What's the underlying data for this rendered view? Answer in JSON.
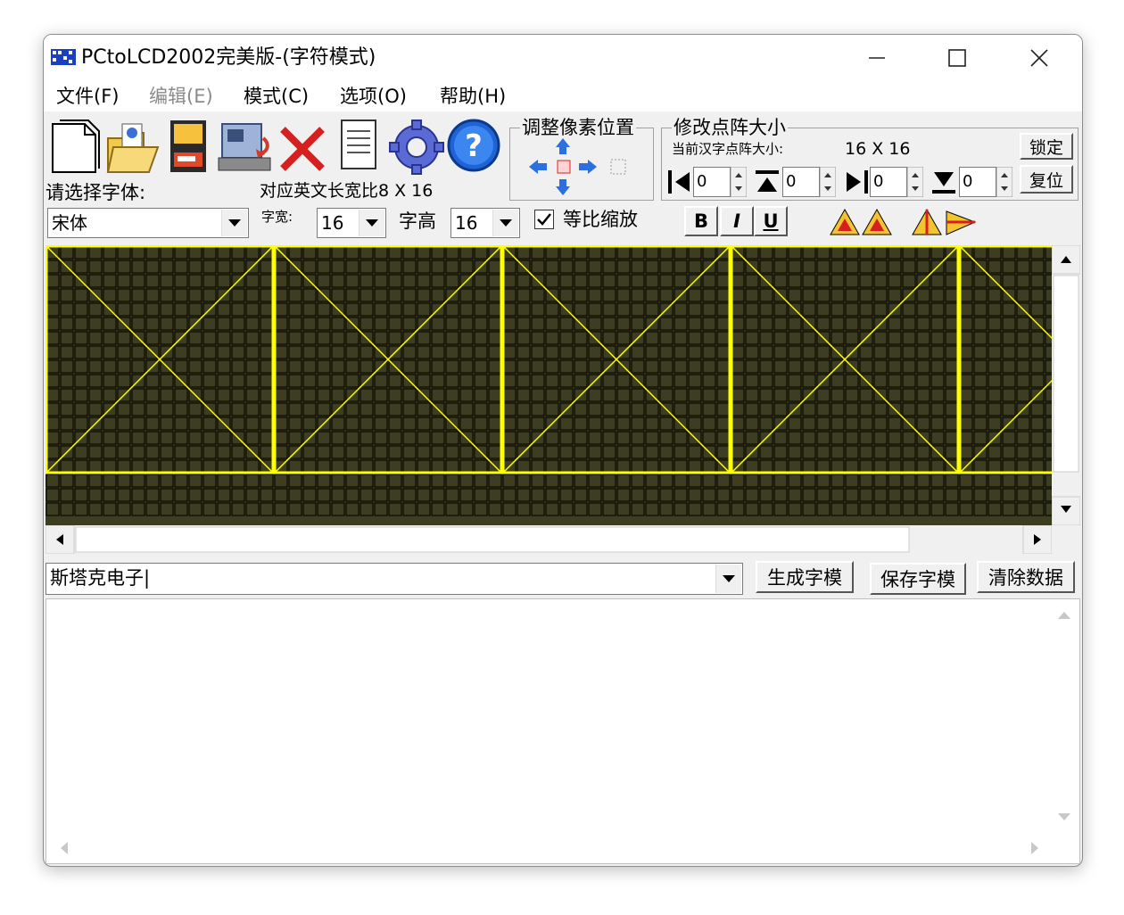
{
  "window": {
    "title": "PCtoLCD2002完美版-(字符模式)"
  },
  "menu": [
    {
      "label": "文件(F)",
      "enabled": true
    },
    {
      "label": "编辑(E)",
      "enabled": false
    },
    {
      "label": "模式(C)",
      "enabled": true
    },
    {
      "label": "选项(O)",
      "enabled": true
    },
    {
      "label": "帮助(H)",
      "enabled": true
    }
  ],
  "toolbar": {
    "icons": [
      "new-file-icon",
      "open-folder-icon",
      "save-disk-icon",
      "import-image-icon",
      "delete-icon",
      "notepad-icon",
      "settings-gear-icon",
      "help-icon"
    ]
  },
  "adjust_pixel": {
    "title": "调整像素位置"
  },
  "resize": {
    "title": "修改点阵大小",
    "current_label": "当前汉字点阵大小:",
    "current_value": "16 X 16",
    "lock_button": "锁定",
    "reset_button": "复位",
    "spinners": [
      "0",
      "0",
      "0",
      "0"
    ]
  },
  "font": {
    "select_label": "请选择字体:",
    "ratio_label": "对应英文长宽比8 X 16",
    "name": "宋体",
    "width_label": "字宽:",
    "width_value": "16",
    "height_label": "字高",
    "height_value": "16",
    "proportional_label": "等比缩放",
    "proportional_checked": true
  },
  "style_buttons": [
    "B",
    "I",
    "U"
  ],
  "input": {
    "text": "斯塔克电子|"
  },
  "actions": {
    "generate": "生成字模",
    "save": "保存字模",
    "clear": "清除数据"
  },
  "colors": {
    "grid_bg": "#3d3d22",
    "pixel_on": "#87dcec",
    "guide": "#ffff00",
    "grid_line": "#000000"
  },
  "glyphs": {
    "rows": 16,
    "cols_per_char": 16,
    "visible_chars": 5,
    "chars": [
      [
        "0000000000000000",
        "0000000000000000",
        "0000000000000000",
        "0000000000000000",
        "0000000000000000",
        "0000000000000000",
        "0000000000000000",
        "0000000000000000",
        "0000000000000000",
        "0000000000000000",
        "0000000000000000",
        "0000000000000000",
        "0000000000000000",
        "0000000000000000",
        "0000000000000000",
        "0000000000000000"
      ],
      [
        "0000000000000000",
        "0000000000000000",
        "0000000000000000",
        "0000000000000000",
        "0000000000000000",
        "0000000000000000",
        "0000000000000000",
        "0000000000000000",
        "0000000000000000",
        "0000000000000000",
        "0000000000000000",
        "0000000000000000",
        "0000000000000000",
        "0000000000000000",
        "0000000000000000",
        "0000000000000000"
      ],
      [
        "0000000000000000",
        "0000000000000000",
        "0000000000000000",
        "0000000000000000",
        "0000000000000000",
        "0000000000000000",
        "0000000000000000",
        "0000000000000000",
        "0000000000000000",
        "0000000000000000",
        "0000000000000000",
        "0000000000000000",
        "0000000000000000",
        "0000000000000000",
        "0000000000000000",
        "0000000000000000"
      ],
      [
        "0000000000000000",
        "0000000000000000",
        "0000000000000000",
        "0000000000000000",
        "0000000000000000",
        "0000000000000000",
        "0000000000000000",
        "0000000000000000",
        "0000000000000000",
        "0000000000000000",
        "0000000000000000",
        "0000000000000000",
        "0000000000000000",
        "0000000000000000",
        "0000000000000000",
        "0000000000000000"
      ],
      [
        "0000000000000000",
        "0000000000000000",
        "0000000000000000",
        "0000000000000000",
        "0000000000000000",
        "0000000000000000",
        "0000000000000000",
        "0000000000000000",
        "0000000000000000",
        "0000000000000000",
        "0000000000000000",
        "0000000000000000",
        "0000000000000000",
        "0000000000000000",
        "0000000000000000",
        "0000000000000000"
      ]
    ]
  }
}
